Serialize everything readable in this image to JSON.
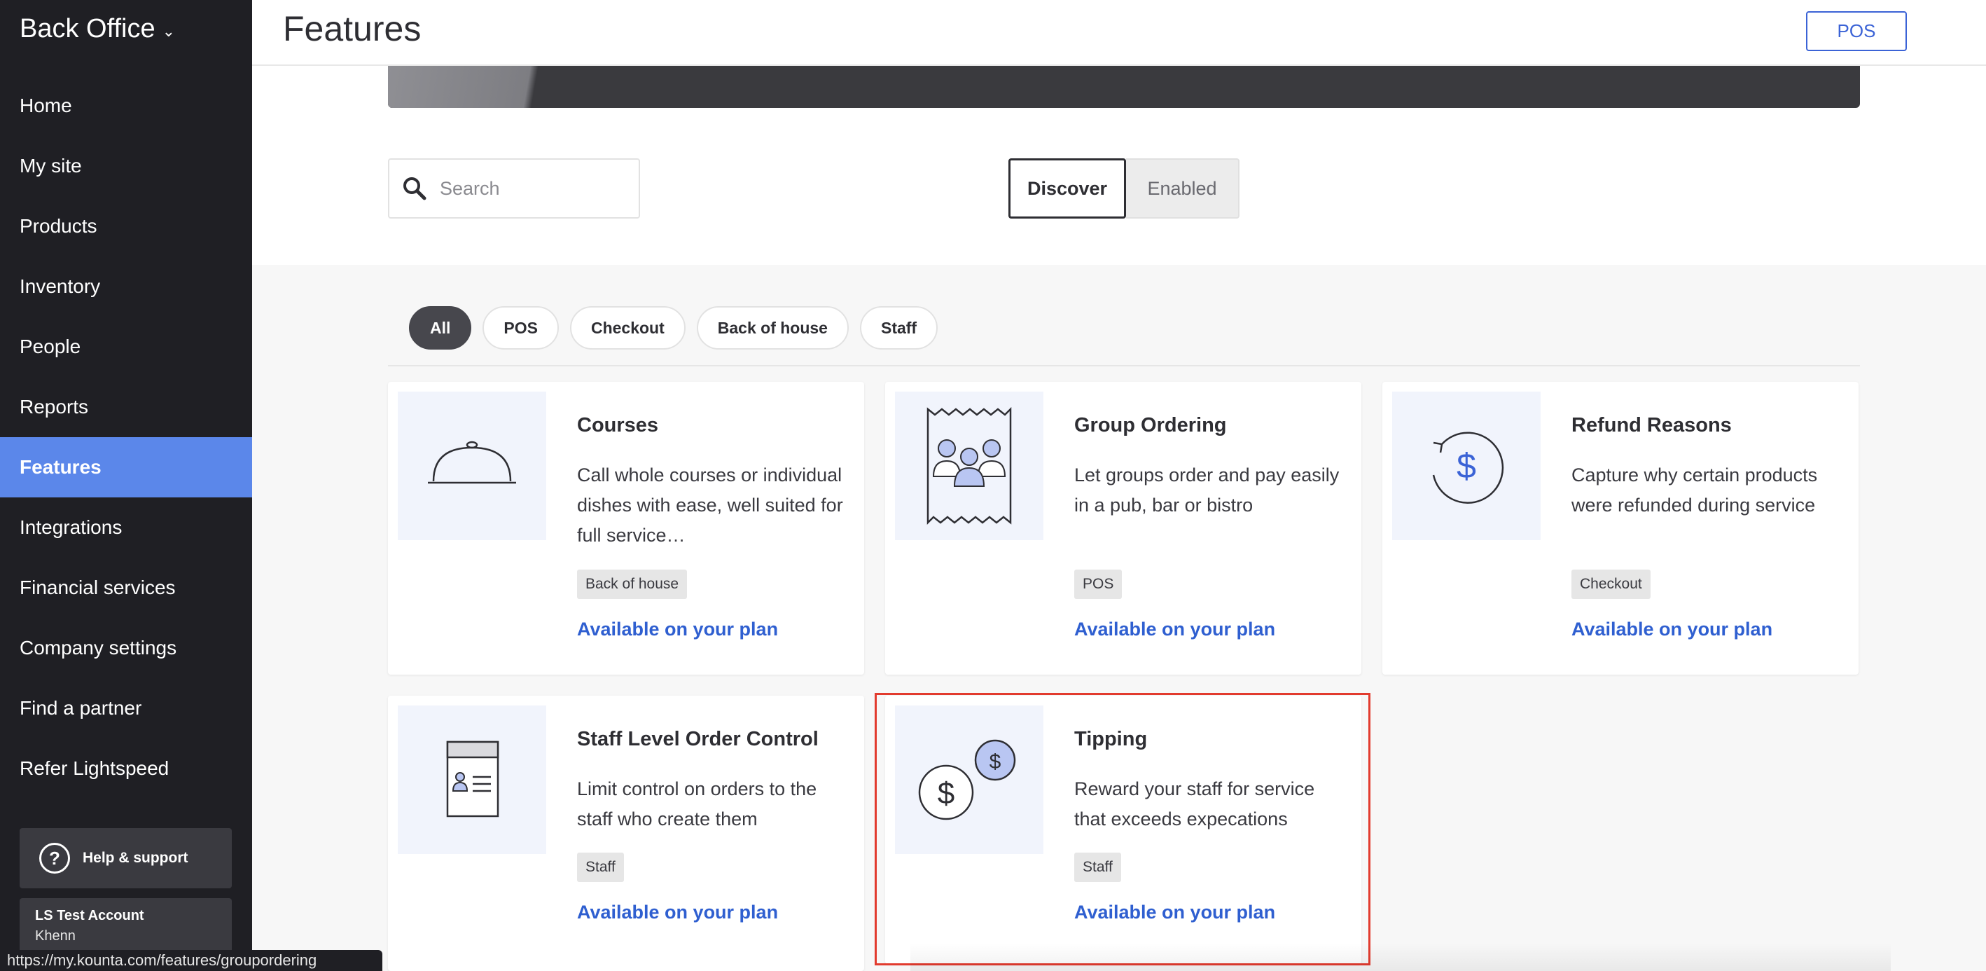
{
  "sidebar": {
    "brand": "Back Office",
    "brand_icon": "chevron-down-icon",
    "items": [
      {
        "label": "Home"
      },
      {
        "label": "My site"
      },
      {
        "label": "Products"
      },
      {
        "label": "Inventory"
      },
      {
        "label": "People"
      },
      {
        "label": "Reports"
      },
      {
        "label": "Features",
        "active": true
      },
      {
        "label": "Integrations"
      },
      {
        "label": "Financial services"
      },
      {
        "label": "Company settings"
      },
      {
        "label": "Find a partner"
      },
      {
        "label": "Refer Lightspeed"
      }
    ],
    "help_label": "Help & support",
    "help_icon_glyph": "?",
    "account_name": "LS Test Account",
    "account_user": "Khenn"
  },
  "status_url": "https://my.kounta.com/features/groupordering",
  "header": {
    "title": "Features",
    "pos_button": "POS"
  },
  "search": {
    "placeholder": "Search",
    "icon": "search-icon"
  },
  "view_toggle": {
    "discover": "Discover",
    "enabled": "Enabled",
    "selected": "Discover"
  },
  "filters": [
    {
      "label": "All",
      "active": true
    },
    {
      "label": "POS"
    },
    {
      "label": "Checkout"
    },
    {
      "label": "Back of house"
    },
    {
      "label": "Staff"
    }
  ],
  "cards": [
    {
      "title": "Courses",
      "description": "Call whole courses or individual dishes with ease, well suited for full service…",
      "tag": "Back of house",
      "availability": "Available on your plan",
      "icon": "cloche-icon"
    },
    {
      "title": "Group Ordering",
      "description": "Let groups order and pay easily in a pub, bar or bistro",
      "tag": "POS",
      "availability": "Available on your plan",
      "icon": "group-receipt-icon"
    },
    {
      "title": "Refund Reasons",
      "description": "Capture why certain products were refunded during service",
      "tag": "Checkout",
      "availability": "Available on your plan",
      "icon": "refund-dollar-icon"
    },
    {
      "title": "Staff Level Order Control",
      "description": "Limit control on orders to the staff who create them",
      "tag": "Staff",
      "availability": "Available on your plan",
      "icon": "staff-order-doc-icon"
    },
    {
      "title": "Tipping",
      "description": "Reward your staff for service that exceeds expecations",
      "tag": "Staff",
      "availability": "Available on your plan",
      "icon": "tip-coins-icon",
      "highlighted": true
    }
  ],
  "colors": {
    "sidebar_bg": "#1f1f24",
    "accent": "#5b87ea",
    "link": "#2f5fd0",
    "highlight": "#e23b2e"
  }
}
